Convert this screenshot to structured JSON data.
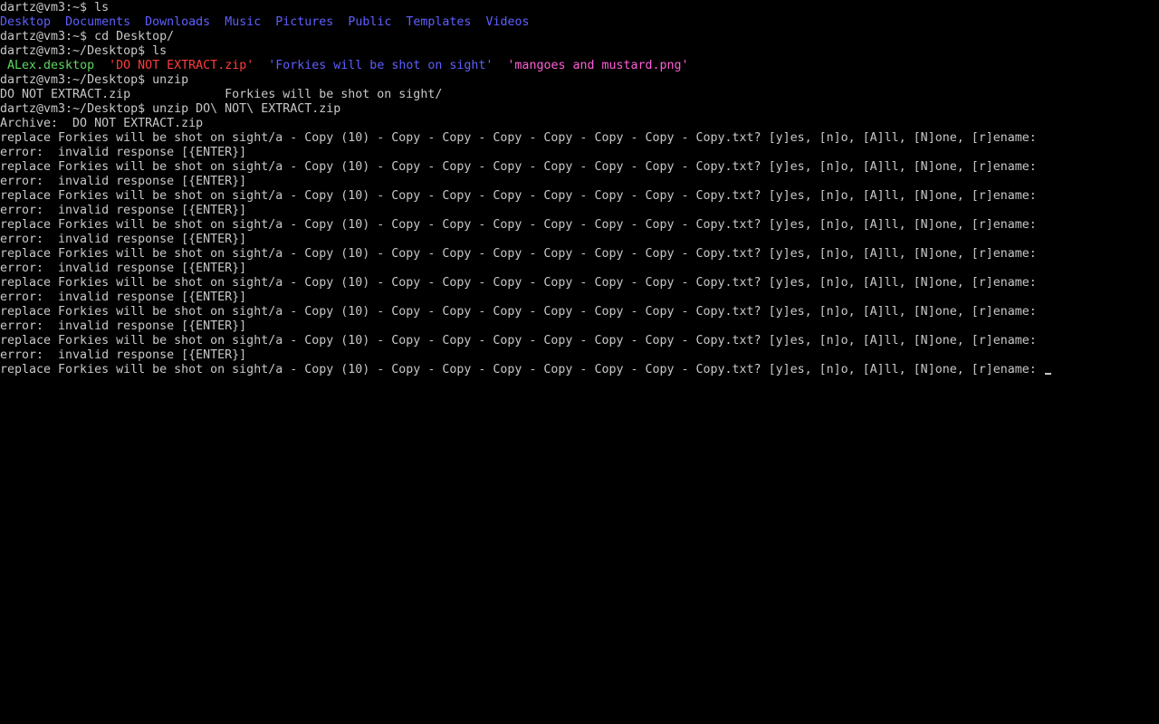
{
  "terminal": {
    "colors": {
      "default": "#c8c8c8",
      "directory": "#5f5fff",
      "desktop_file": "#5fd75f",
      "archive": "#ff3c3c",
      "image": "#ff5fd7",
      "background": "#000000"
    },
    "lines": [
      {
        "segments": [
          {
            "text": "dartz@vm3:~$ ls",
            "color": "#c8c8c8"
          }
        ]
      },
      {
        "segments": [
          {
            "text": "Desktop",
            "color": "#5f5fff"
          },
          {
            "text": "  ",
            "color": "#c8c8c8"
          },
          {
            "text": "Documents",
            "color": "#5f5fff"
          },
          {
            "text": "  ",
            "color": "#c8c8c8"
          },
          {
            "text": "Downloads",
            "color": "#5f5fff"
          },
          {
            "text": "  ",
            "color": "#c8c8c8"
          },
          {
            "text": "Music",
            "color": "#5f5fff"
          },
          {
            "text": "  ",
            "color": "#c8c8c8"
          },
          {
            "text": "Pictures",
            "color": "#5f5fff"
          },
          {
            "text": "  ",
            "color": "#c8c8c8"
          },
          {
            "text": "Public",
            "color": "#5f5fff"
          },
          {
            "text": "  ",
            "color": "#c8c8c8"
          },
          {
            "text": "Templates",
            "color": "#5f5fff"
          },
          {
            "text": "  ",
            "color": "#c8c8c8"
          },
          {
            "text": "Videos",
            "color": "#5f5fff"
          }
        ]
      },
      {
        "segments": [
          {
            "text": "dartz@vm3:~$ cd Desktop/",
            "color": "#c8c8c8"
          }
        ]
      },
      {
        "segments": [
          {
            "text": "dartz@vm3:~/Desktop$ ls",
            "color": "#c8c8c8"
          }
        ]
      },
      {
        "segments": [
          {
            "text": " ",
            "color": "#c8c8c8"
          },
          {
            "text": "ALex.desktop",
            "color": "#5fd75f"
          },
          {
            "text": "  ",
            "color": "#c8c8c8"
          },
          {
            "text": "'DO NOT EXTRACT.zip'",
            "color": "#ff3c3c"
          },
          {
            "text": "  ",
            "color": "#c8c8c8"
          },
          {
            "text": "'Forkies will be shot on sight'",
            "color": "#5f5fff"
          },
          {
            "text": "  ",
            "color": "#c8c8c8"
          },
          {
            "text": "'mangoes and mustard.png'",
            "color": "#ff5fd7"
          }
        ]
      },
      {
        "segments": [
          {
            "text": "dartz@vm3:~/Desktop$ unzip",
            "color": "#c8c8c8"
          }
        ]
      },
      {
        "segments": [
          {
            "text": "DO NOT EXTRACT.zip             Forkies will be shot on sight/",
            "color": "#c8c8c8"
          }
        ]
      },
      {
        "segments": [
          {
            "text": "dartz@vm3:~/Desktop$ unzip DO\\ NOT\\ EXTRACT.zip",
            "color": "#c8c8c8"
          }
        ]
      },
      {
        "segments": [
          {
            "text": "Archive:  DO NOT EXTRACT.zip",
            "color": "#c8c8c8"
          }
        ]
      },
      {
        "segments": [
          {
            "text": "replace Forkies will be shot on sight/a - Copy (10) - Copy - Copy - Copy - Copy - Copy - Copy - Copy.txt? [y]es, [n]o, [A]ll, [N]one, [r]ename:",
            "color": "#c8c8c8"
          }
        ]
      },
      {
        "segments": [
          {
            "text": "error:  invalid response [{ENTER}]",
            "color": "#c8c8c8"
          }
        ]
      },
      {
        "segments": [
          {
            "text": "replace Forkies will be shot on sight/a - Copy (10) - Copy - Copy - Copy - Copy - Copy - Copy - Copy.txt? [y]es, [n]o, [A]ll, [N]one, [r]ename:",
            "color": "#c8c8c8"
          }
        ]
      },
      {
        "segments": [
          {
            "text": "error:  invalid response [{ENTER}]",
            "color": "#c8c8c8"
          }
        ]
      },
      {
        "segments": [
          {
            "text": "replace Forkies will be shot on sight/a - Copy (10) - Copy - Copy - Copy - Copy - Copy - Copy - Copy.txt? [y]es, [n]o, [A]ll, [N]one, [r]ename:",
            "color": "#c8c8c8"
          }
        ]
      },
      {
        "segments": [
          {
            "text": "error:  invalid response [{ENTER}]",
            "color": "#c8c8c8"
          }
        ]
      },
      {
        "segments": [
          {
            "text": "replace Forkies will be shot on sight/a - Copy (10) - Copy - Copy - Copy - Copy - Copy - Copy - Copy.txt? [y]es, [n]o, [A]ll, [N]one, [r]ename:",
            "color": "#c8c8c8"
          }
        ]
      },
      {
        "segments": [
          {
            "text": "error:  invalid response [{ENTER}]",
            "color": "#c8c8c8"
          }
        ]
      },
      {
        "segments": [
          {
            "text": "replace Forkies will be shot on sight/a - Copy (10) - Copy - Copy - Copy - Copy - Copy - Copy - Copy.txt? [y]es, [n]o, [A]ll, [N]one, [r]ename:",
            "color": "#c8c8c8"
          }
        ]
      },
      {
        "segments": [
          {
            "text": "error:  invalid response [{ENTER}]",
            "color": "#c8c8c8"
          }
        ]
      },
      {
        "segments": [
          {
            "text": "replace Forkies will be shot on sight/a - Copy (10) - Copy - Copy - Copy - Copy - Copy - Copy - Copy.txt? [y]es, [n]o, [A]ll, [N]one, [r]ename:",
            "color": "#c8c8c8"
          }
        ]
      },
      {
        "segments": [
          {
            "text": "error:  invalid response [{ENTER}]",
            "color": "#c8c8c8"
          }
        ]
      },
      {
        "segments": [
          {
            "text": "replace Forkies will be shot on sight/a - Copy (10) - Copy - Copy - Copy - Copy - Copy - Copy - Copy.txt? [y]es, [n]o, [A]ll, [N]one, [r]ename:",
            "color": "#c8c8c8"
          }
        ]
      },
      {
        "segments": [
          {
            "text": "error:  invalid response [{ENTER}]",
            "color": "#c8c8c8"
          }
        ]
      },
      {
        "segments": [
          {
            "text": "replace Forkies will be shot on sight/a - Copy (10) - Copy - Copy - Copy - Copy - Copy - Copy - Copy.txt? [y]es, [n]o, [A]ll, [N]one, [r]ename:",
            "color": "#c8c8c8"
          }
        ]
      },
      {
        "segments": [
          {
            "text": "error:  invalid response [{ENTER}]",
            "color": "#c8c8c8"
          }
        ]
      },
      {
        "segments": [
          {
            "text": "replace Forkies will be shot on sight/a - Copy (10) - Copy - Copy - Copy - Copy - Copy - Copy - Copy.txt? [y]es, [n]o, [A]ll, [N]one, [r]ename: ",
            "color": "#c8c8c8"
          }
        ],
        "cursor": true
      }
    ]
  }
}
